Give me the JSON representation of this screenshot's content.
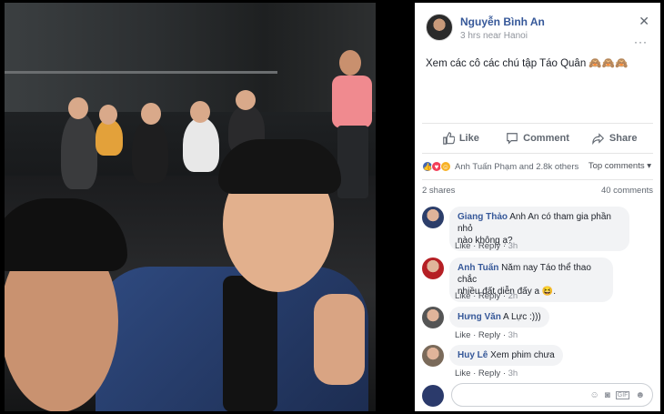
{
  "post": {
    "author": "Nguyễn Bình An",
    "meta": "3 hrs near Hanoi",
    "caption": "Xem các cô các chú tập Táo Quân 🙈🙈🙈",
    "close_icon": "✕",
    "more_icon": "···"
  },
  "actions": {
    "like": "Like",
    "comment": "Comment",
    "share": "Share"
  },
  "reactions": {
    "summary": "Anh Tuấn Phạm and 2.8k others",
    "top_comments": "Top comments ▾",
    "shares": "2 shares",
    "comments_count": "40 comments",
    "colors": {
      "like": "#4267b2",
      "love": "#f33e58",
      "haha": "#f7b125"
    }
  },
  "comments": [
    {
      "name": "Giang Thảo",
      "text": "Anh An có tham gia phần nhỏ nào không ạ?",
      "line1": "Anh An có tham gia phần nhỏ",
      "line2": "nào không ạ?",
      "like": "Like",
      "reply": "Reply",
      "time": "3h"
    },
    {
      "name": "Anh Tuấn",
      "text": "Năm nay Táo thể thao chắc nhiều đất diễn đấy a 😆.",
      "line1": "Năm nay Táo thể thao chắc",
      "line2": "nhiều đất diễn đấy a 😆.",
      "like": "Like",
      "reply": "Reply",
      "time": "2h"
    },
    {
      "name": "Hưng Văn",
      "text": "A Lực :)))",
      "like": "Like",
      "reply": "Reply",
      "time": "3h"
    },
    {
      "name": "Huy Lê",
      "text": "Xem phim chưa",
      "like": "Like",
      "reply": "Reply",
      "time": "3h"
    }
  ],
  "composer": {
    "icons": [
      "emoji-icon",
      "camera-icon",
      "gif-icon",
      "sticker-icon"
    ]
  }
}
